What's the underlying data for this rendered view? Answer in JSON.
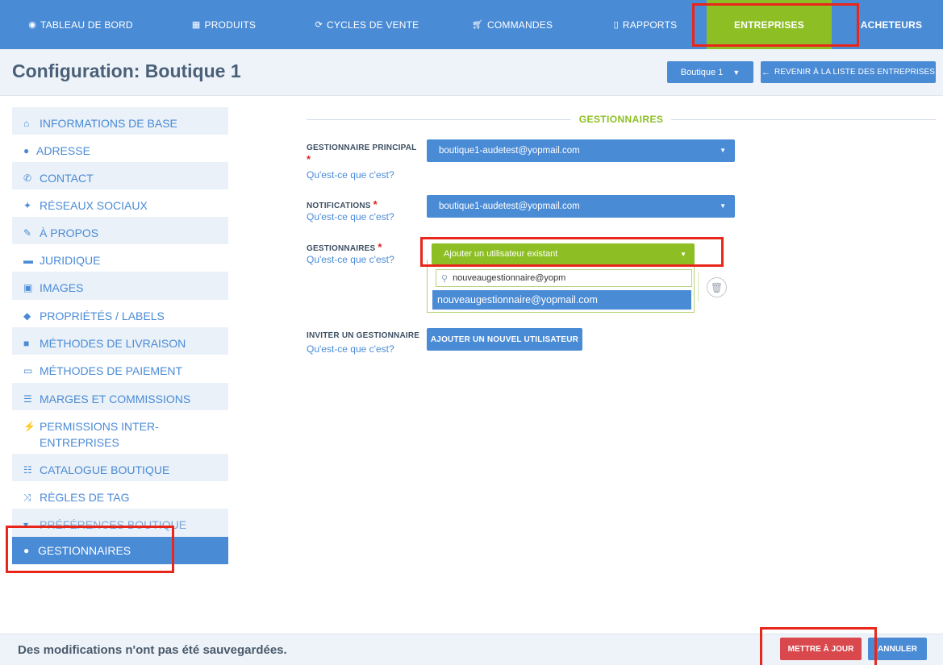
{
  "nav": {
    "items": [
      {
        "label": "TABLEAU DE BORD",
        "icon": "dashboard-icon"
      },
      {
        "label": "PRODUITS",
        "icon": "grid-icon"
      },
      {
        "label": "CYCLES DE VENTE",
        "icon": "refresh-icon"
      },
      {
        "label": "COMMANDES",
        "icon": "cart-icon"
      },
      {
        "label": "RAPPORTS",
        "icon": "file-icon"
      },
      {
        "label": "ENTREPRISES",
        "icon": ""
      },
      {
        "label": "ACHETEURS",
        "icon": ""
      }
    ],
    "active": "ENTREPRISES"
  },
  "header": {
    "title": "Configuration: Boutique 1",
    "store_select": "Boutique 1",
    "back_button": "REVENIR À LA LISTE DES ENTREPRISES"
  },
  "sidebar": {
    "items": [
      {
        "label": "INFORMATIONS DE BASE",
        "icon": "home-icon"
      },
      {
        "label": "ADRESSE",
        "icon": "map-marker-icon"
      },
      {
        "label": "CONTACT",
        "icon": "phone-icon"
      },
      {
        "label": "RÉSEAUX SOCIAUX",
        "icon": "twitter-icon"
      },
      {
        "label": "À PROPOS",
        "icon": "pencil-icon"
      },
      {
        "label": "JURIDIQUE",
        "icon": "briefcase-icon"
      },
      {
        "label": "IMAGES",
        "icon": "image-icon"
      },
      {
        "label": "PROPRIÉTÉS / LABELS",
        "icon": "tags-icon"
      },
      {
        "label": "MÉTHODES DE LIVRAISON",
        "icon": "truck-icon"
      },
      {
        "label": "MÉTHODES DE PAIEMENT",
        "icon": "money-icon"
      },
      {
        "label": "MARGES ET COMMISSIONS",
        "icon": "list-alt-icon"
      },
      {
        "label": "PERMISSIONS INTER-ENTREPRISES",
        "icon": "plug-icon"
      },
      {
        "label": "CATALOGUE BOUTIQUE",
        "icon": "list-icon"
      },
      {
        "label": "RÈGLES DE TAG",
        "icon": "random-icon"
      },
      {
        "label": "PRÉFÉRENCES BOUTIQUE",
        "icon": "cart-icon"
      },
      {
        "label": "GESTIONNAIRES",
        "icon": "user-icon"
      }
    ],
    "active": "GESTIONNAIRES"
  },
  "form": {
    "section_title": "GESTIONNAIRES",
    "help_text": "Qu'est-ce que c'est?",
    "required_mark": "*",
    "main_manager": {
      "label": "GESTIONNAIRE PRINCIPAL",
      "value": "boutique1-audetest@yopmail.com"
    },
    "notifications": {
      "label": "NOTIFICATIONS",
      "value": "boutique1-audetest@yopmail.com"
    },
    "managers": {
      "label": "GESTIONNAIRES",
      "dropdown_label": "Ajouter un utilisateur existant",
      "search_value": "nouveaugestionnaire@yopm",
      "option": "nouveaugestionnaire@yopmail.com"
    },
    "invite": {
      "label": "INVITER UN GESTIONNAIRE",
      "button": "AJOUTER UN NOUVEL UTILISATEUR"
    }
  },
  "footer": {
    "message": "Des modifications n'ont pas été sauvegardées.",
    "update_button": "METTRE À JOUR",
    "cancel_button": "ANNULER"
  },
  "colors": {
    "primary": "#4a8bd6",
    "accent_green": "#8dbf24",
    "danger": "#d9484c",
    "highlight_red": "#e8261a"
  }
}
